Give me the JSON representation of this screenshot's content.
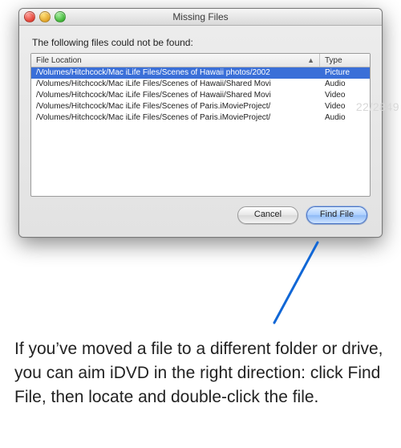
{
  "window": {
    "title": "Missing Files",
    "message": "The following files could not be found:",
    "columns": {
      "location": "File Location",
      "type": "Type"
    },
    "rows": [
      {
        "location": "/Volumes/Hitchcock/Mac iLife Files/Scenes of Hawaii photos/2002",
        "type": "Picture",
        "selected": true
      },
      {
        "location": "/Volumes/Hitchcock/Mac iLife Files/Scenes of Hawaii/Shared Movi",
        "type": "Audio",
        "selected": false
      },
      {
        "location": "/Volumes/Hitchcock/Mac iLife Files/Scenes of Hawaii/Shared Movi",
        "type": "Video",
        "selected": false
      },
      {
        "location": "/Volumes/Hitchcock/Mac iLife Files/Scenes of Paris.iMovieProject/",
        "type": "Video",
        "selected": false
      },
      {
        "location": "/Volumes/Hitchcock/Mac iLife Files/Scenes of Paris.iMovieProject/",
        "type": "Audio",
        "selected": false
      }
    ],
    "buttons": {
      "cancel": "Cancel",
      "find": "Find File"
    }
  },
  "caption": "If you’ve moved a file to a different folder or drive, you can aim iDVD in the right direction: click Find File, then locate and double-click the file.",
  "watermark": "22/2849"
}
